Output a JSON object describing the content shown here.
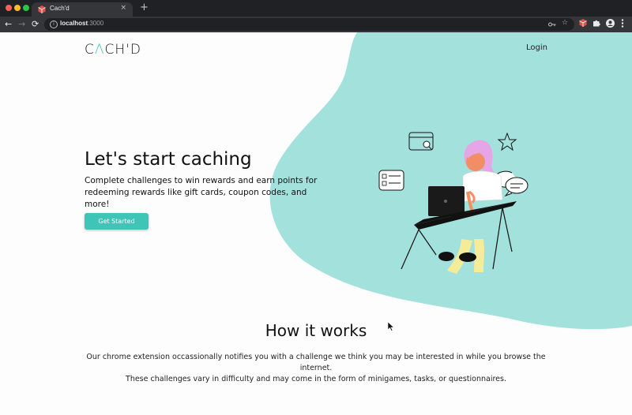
{
  "browser": {
    "tab_title": "Cach'd",
    "tab_close": "×",
    "new_tab": "+",
    "url_host": "localhost",
    "url_port": ":3000",
    "back": "←",
    "forward": "→",
    "reload": "⟳"
  },
  "brand": {
    "logo_c": "C",
    "logo_accent": "Λ",
    "logo_rest": "CH'D",
    "accent_color": "#3ec5b8"
  },
  "nav": {
    "login": "Login"
  },
  "hero": {
    "title": "Let's start caching",
    "subtitle": "Complete challenges to win rewards and earn points for redeeming rewards like gift cards, coupon codes, and more!",
    "cta": "Get Started"
  },
  "how": {
    "title": "How it works",
    "description_line1": "Our chrome extension occassionally notifies you with a challenge we think you may be interested in while you browse the internet.",
    "description_line2": "These challenges vary in difficulty and may come in the form of minigames, tasks, or questionnaires."
  },
  "icons": [
    "cube-favicon-icon",
    "key-icon",
    "star-icon",
    "extension-icon",
    "puzzle-icon",
    "profile-icon",
    "menu-icon"
  ]
}
